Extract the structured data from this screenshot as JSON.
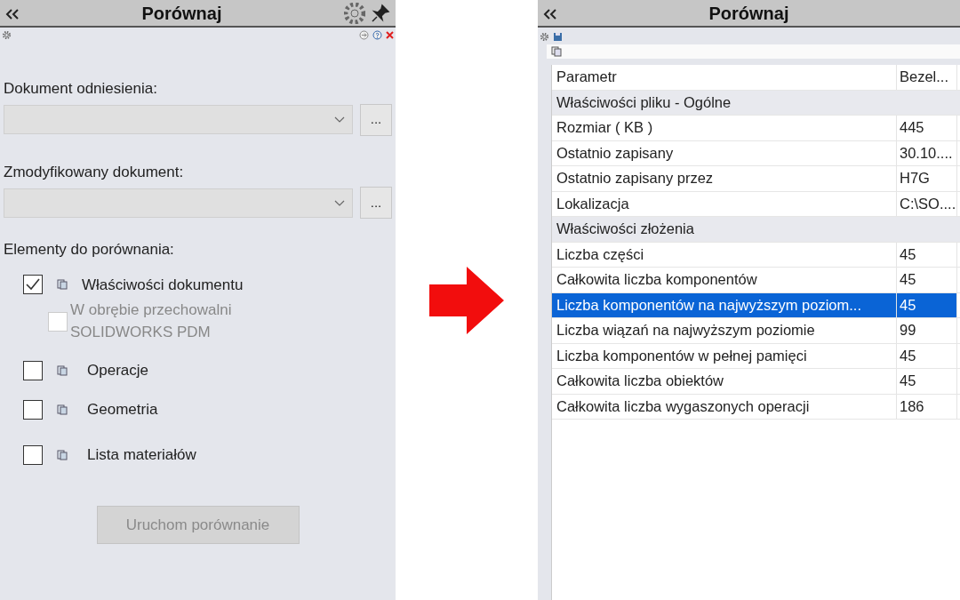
{
  "left_panel": {
    "title": "Porównaj",
    "reference": {
      "label": "Dokument odniesienia:",
      "browse": "..."
    },
    "modified": {
      "label": "Zmodyfikowany dokument:",
      "browse": "..."
    },
    "items_label": "Elementy do porównania:",
    "items": [
      {
        "label": "Właściwości dokumentu",
        "checked": true,
        "disabled": false,
        "children": [
          {
            "label": "W obrębie przechowalni SOLIDWORKS PDM",
            "checked": false,
            "disabled": true
          }
        ]
      },
      {
        "label": "Operacje",
        "checked": false,
        "disabled": false
      },
      {
        "label": "Geometria",
        "checked": false,
        "disabled": false
      },
      {
        "label": "Lista materiałów",
        "checked": false,
        "disabled": false
      }
    ],
    "run_button": {
      "label": "Uruchom porównanie",
      "disabled": true
    }
  },
  "right_panel": {
    "title": "Porównaj",
    "table": {
      "columns": [
        "Parametr",
        "Bezel..."
      ],
      "rows": [
        {
          "kind": "group",
          "cells": [
            "Właściwości pliku - Ogólne"
          ],
          "selected": false
        },
        {
          "kind": "row",
          "cells": [
            "Rozmiar ( KB )",
            "445"
          ],
          "selected": false
        },
        {
          "kind": "row",
          "cells": [
            "Ostatnio zapisany",
            "30.10...."
          ],
          "selected": false
        },
        {
          "kind": "row",
          "cells": [
            "Ostatnio zapisany przez",
            "H7G"
          ],
          "selected": false
        },
        {
          "kind": "row",
          "cells": [
            "Lokalizacja",
            "C:\\SO...."
          ],
          "selected": false
        },
        {
          "kind": "group",
          "cells": [
            "Właściwości złożenia"
          ],
          "selected": false
        },
        {
          "kind": "row",
          "cells": [
            "Liczba części",
            "45"
          ],
          "selected": false
        },
        {
          "kind": "row",
          "cells": [
            "Całkowita liczba komponentów",
            "45"
          ],
          "selected": false
        },
        {
          "kind": "row",
          "cells": [
            "Liczba komponentów na najwyższym poziom...",
            "45"
          ],
          "selected": true
        },
        {
          "kind": "row",
          "cells": [
            "Liczba wiązań na najwyższym poziomie",
            "99"
          ],
          "selected": false
        },
        {
          "kind": "row",
          "cells": [
            "Liczba komponentów w pełnej pamięci",
            "45"
          ],
          "selected": false
        },
        {
          "kind": "row",
          "cells": [
            "Całkowita liczba obiektów",
            "45"
          ],
          "selected": false
        },
        {
          "kind": "row",
          "cells": [
            "Całkowita liczba wygaszonych operacji",
            "186"
          ],
          "selected": false
        }
      ]
    }
  }
}
